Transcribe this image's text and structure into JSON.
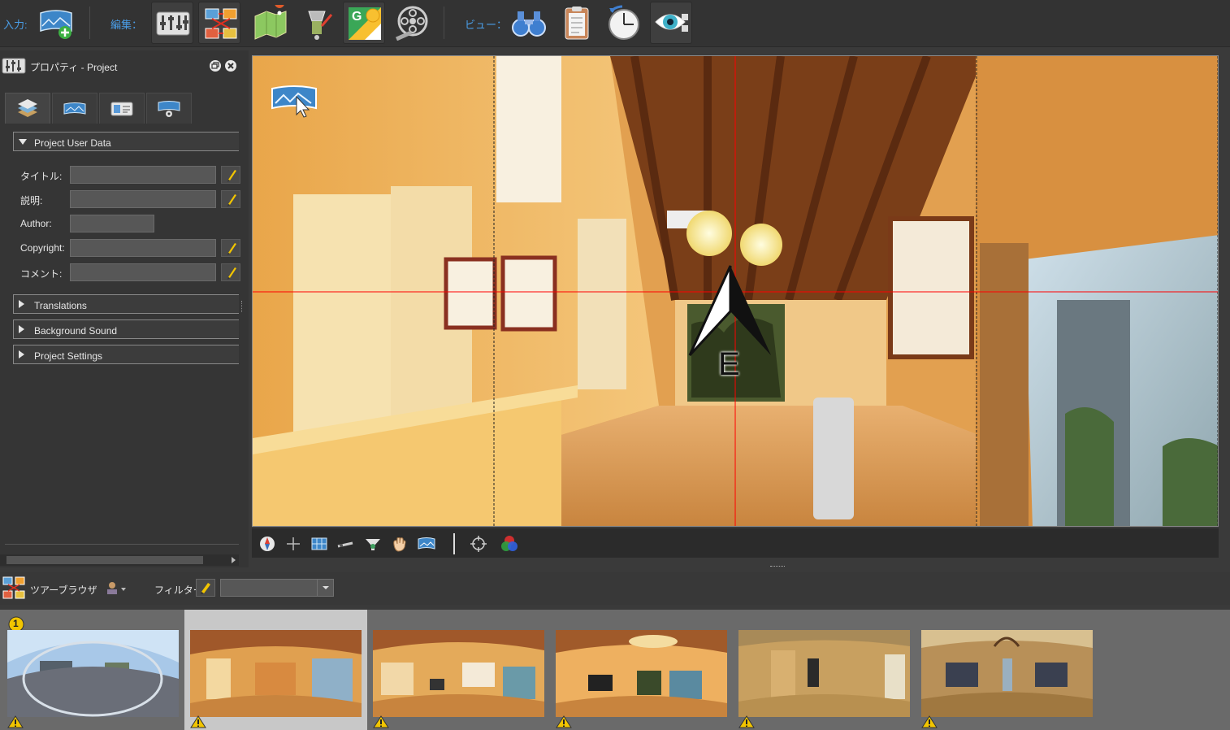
{
  "toolbar": {
    "input_label": "入力:",
    "edit_label": "編集：",
    "view_label": "ビュー：",
    "buttons": {
      "input": "add-panorama-icon",
      "edit": [
        "properties-mixer-icon",
        "tour-map-icon",
        "floorplan-icon",
        "hotspot-editor-icon",
        "google-street-view-icon",
        "film-reel-icon"
      ],
      "view": [
        "binoculars-icon",
        "clipboard-icon",
        "timer-icon",
        "eye-preview-icon"
      ]
    }
  },
  "properties": {
    "title": "プロパティ - Project",
    "tabs": [
      "project-tab",
      "panorama-tab",
      "user-data-tab",
      "viewer-tab"
    ],
    "sections": {
      "user_data": "Project User Data",
      "translations": "Translations",
      "background_sound": "Background Sound",
      "project_settings": "Project Settings"
    },
    "fields": [
      {
        "label": "タイトル:",
        "value": ""
      },
      {
        "label": "説明:",
        "value": ""
      },
      {
        "label": "Author:",
        "value": ""
      },
      {
        "label": "Copyright:",
        "value": ""
      },
      {
        "label": "コメント:",
        "value": ""
      }
    ]
  },
  "viewer": {
    "compass_letter": "E",
    "grid_color": "#ff0000"
  },
  "browser": {
    "title": "ツアーブラウザ",
    "filter_label": "フィルター:",
    "filter_value": "",
    "thumbnails": [
      {
        "name": "pano-1-street",
        "badge": "1",
        "warning": true
      },
      {
        "name": "pano-2-hallway",
        "selected": true,
        "warning": true
      },
      {
        "name": "pano-3-reception",
        "warning": true
      },
      {
        "name": "pano-4-lounge",
        "warning": true
      },
      {
        "name": "pano-5-corridor",
        "warning": true
      },
      {
        "name": "pano-6-room",
        "warning": true
      }
    ]
  },
  "colors": {
    "accent": "#4a9ee8",
    "warning": "#f2c500"
  }
}
